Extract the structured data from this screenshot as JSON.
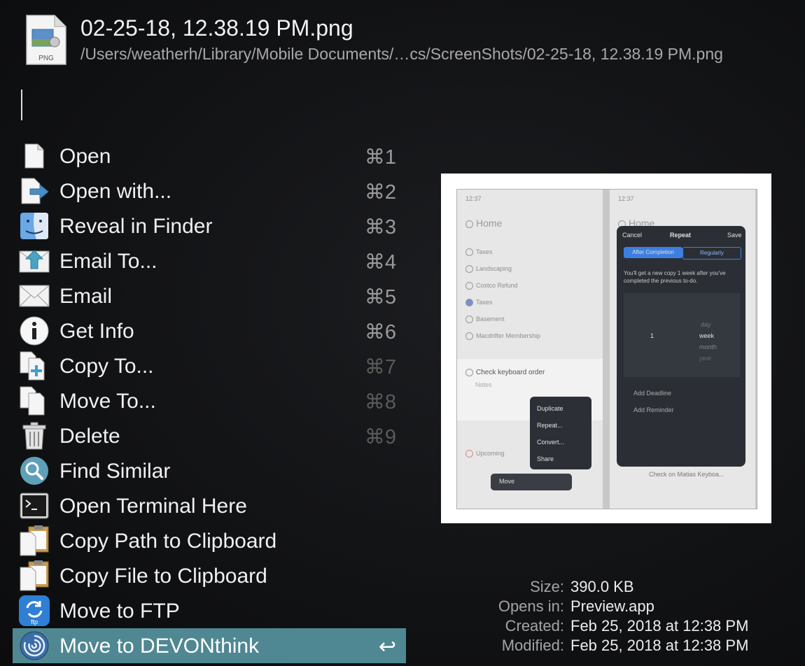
{
  "header": {
    "file_badge": "PNG",
    "title": "02-25-18, 12.38.19 PM.png",
    "path": "/Users/weatherh/Library/Mobile Documents/…cs/ScreenShots/02-25-18, 12.38.19 PM.png"
  },
  "menu": [
    {
      "label": "Open",
      "shortcut": "⌘1",
      "icon": "document-icon"
    },
    {
      "label": "Open with...",
      "shortcut": "⌘2",
      "icon": "open-with-icon"
    },
    {
      "label": "Reveal in Finder",
      "shortcut": "⌘3",
      "icon": "finder-icon"
    },
    {
      "label": "Email To...",
      "shortcut": "⌘4",
      "icon": "email-to-icon"
    },
    {
      "label": "Email",
      "shortcut": "⌘5",
      "icon": "envelope-icon"
    },
    {
      "label": "Get Info",
      "shortcut": "⌘6",
      "icon": "info-icon"
    },
    {
      "label": "Copy To...",
      "shortcut": "⌘7",
      "icon": "copy-to-icon"
    },
    {
      "label": "Move To...",
      "shortcut": "⌘8",
      "icon": "move-to-icon"
    },
    {
      "label": "Delete",
      "shortcut": "⌘9",
      "icon": "trash-icon"
    },
    {
      "label": "Find Similar",
      "shortcut": "",
      "icon": "magnifier-icon"
    },
    {
      "label": "Open Terminal Here",
      "shortcut": "",
      "icon": "terminal-icon"
    },
    {
      "label": "Copy Path to Clipboard",
      "shortcut": "",
      "icon": "clipboard-icon"
    },
    {
      "label": "Copy File to Clipboard",
      "shortcut": "",
      "icon": "clipboard-icon"
    },
    {
      "label": "Move to FTP",
      "shortcut": "",
      "icon": "ftp-icon"
    },
    {
      "label": "Move to DEVONthink",
      "shortcut": "↩",
      "icon": "devonthink-icon"
    }
  ],
  "preview": {
    "left_phone": {
      "status_time": "12:37",
      "title": "Home",
      "items": [
        "Taxes",
        "Landscaping",
        "Costco Refund",
        "Taxes",
        "Basement",
        "Macdrifter Membership"
      ],
      "task": "Check keyboard order",
      "notes": "Notes",
      "menu": [
        "Duplicate",
        "Repeat...",
        "Convert...",
        "Share"
      ],
      "section": "Upcoming",
      "bar_label": "Move"
    },
    "right_phone": {
      "status_time": "12:37",
      "title": "Home",
      "cancel": "Cancel",
      "heading": "Repeat",
      "save": "Save",
      "seg_a": "After Completion",
      "seg_b": "Regularly",
      "desc": "You'll get a new copy 1 week after you've completed the previous to-do.",
      "picker_num": "1",
      "picker_units": [
        "day",
        "week",
        "month",
        "year"
      ],
      "deadline": "Add Deadline",
      "reminder": "Add Reminder",
      "bottom": "Check on Matias Keyboa..."
    }
  },
  "info": [
    {
      "key": "Size:",
      "value": "390.0 KB"
    },
    {
      "key": "Opens in:",
      "value": "Preview.app"
    },
    {
      "key": "Created:",
      "value": "Feb 25, 2018 at 12:38 PM"
    },
    {
      "key": "Modified:",
      "value": "Feb 25, 2018 at 12:38 PM"
    }
  ]
}
